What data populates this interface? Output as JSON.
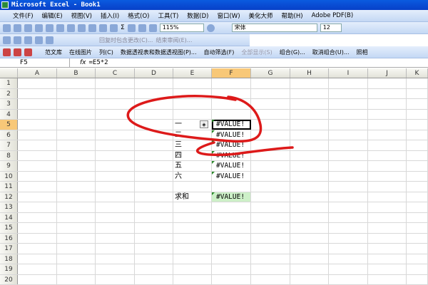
{
  "title": "Microsoft Excel - Book1",
  "menu": [
    "文件(F)",
    "编辑(E)",
    "视图(V)",
    "插入(I)",
    "格式(O)",
    "工具(T)",
    "数据(D)",
    "窗口(W)",
    "美化大师",
    "帮助(H)",
    "Adobe PDF(B)"
  ],
  "toolbar": {
    "zoom": "115%",
    "font": "宋体",
    "size": "12"
  },
  "review_toolbar": {
    "reply": "回复时包含更改(C)...",
    "end_review": "结束审阅(E)..."
  },
  "toolbar3": [
    "范文库",
    "在线图片",
    "列(C)",
    "数据透视表和数据透视图(P)...",
    "自动筛选(F)",
    "全部显示(S)",
    "组合(G)...",
    "取消组合(U)...",
    "照相"
  ],
  "formula_bar": {
    "name_box": "F5",
    "fx": "fx",
    "formula": "=E5*2"
  },
  "columns": [
    "A",
    "B",
    "C",
    "D",
    "E",
    "F",
    "G",
    "H",
    "I",
    "J",
    "K"
  ],
  "rows": [
    "1",
    "2",
    "3",
    "4",
    "5",
    "6",
    "7",
    "8",
    "9",
    "10",
    "11",
    "12",
    "13",
    "14",
    "15",
    "16",
    "17",
    "18",
    "19",
    "20"
  ],
  "cells": {
    "E5": "一",
    "E6": "二",
    "E7": "三",
    "E8": "四",
    "E9": "五",
    "E10": "六",
    "E12": "求和",
    "F5": "#VALUE!",
    "F6": "#VALUE!",
    "F7": "#VALUE!",
    "F8": "#VALUE!",
    "F9": "#VALUE!",
    "F10": "#VALUE!",
    "F12": "#VALUE!"
  },
  "annotation_color": "#dd1a1a"
}
